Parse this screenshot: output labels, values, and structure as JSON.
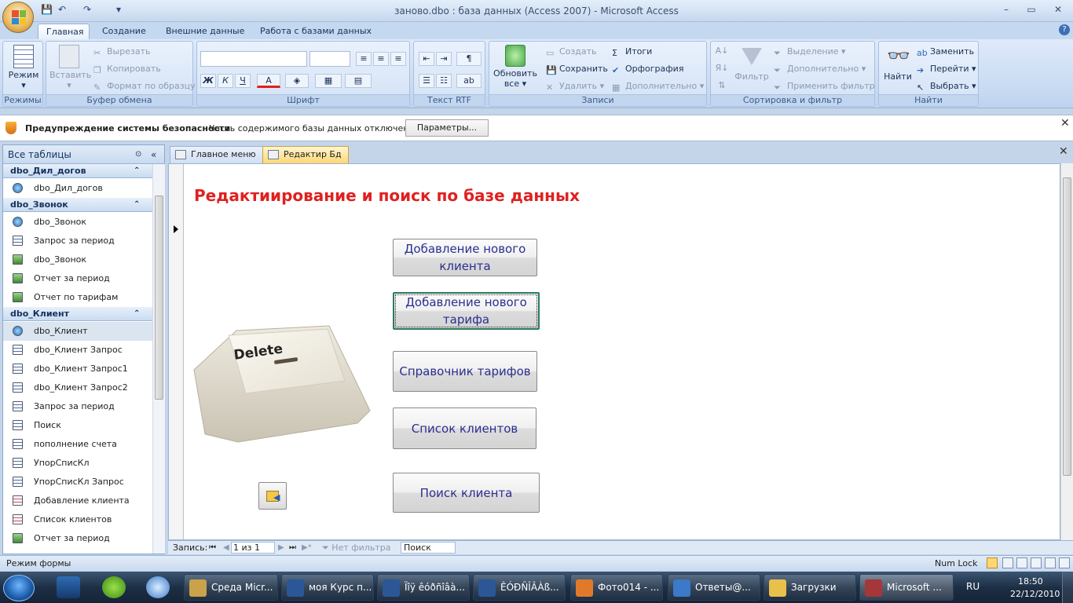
{
  "window": {
    "title": "заново.dbo : база данных (Access 2007) - Microsoft Access"
  },
  "ribbon_tabs": [
    "Главная",
    "Создание",
    "Внешние данные",
    "Работа с базами данных"
  ],
  "ribbon": {
    "modes": {
      "view_label": "Режим",
      "group": "Режимы"
    },
    "clipboard": {
      "paste": "Вставить",
      "cut": "Вырезать",
      "copy": "Копировать",
      "format_painter": "Формат по образцу",
      "group": "Буфер обмена"
    },
    "font": {
      "group": "Шрифт",
      "bold": "Ж",
      "italic": "К",
      "underline": "Ч",
      "font_color": "А"
    },
    "rtf": {
      "group": "Текст RTF"
    },
    "records": {
      "refresh": "Обновить",
      "refresh_all": "все",
      "new": "Создать",
      "save": "Сохранить",
      "delete": "Удалить",
      "totals": "Итоги",
      "spelling": "Орфография",
      "more": "Дополнительно",
      "group": "Записи"
    },
    "sort": {
      "filter": "Фильтр",
      "selection": "Выделение",
      "advanced": "Дополнительно",
      "toggle": "Применить фильтр",
      "group": "Сортировка и фильтр"
    },
    "find": {
      "find": "Найти",
      "replace": "Заменить",
      "goto": "Перейти",
      "select": "Выбрать",
      "group": "Найти"
    }
  },
  "security_bar": {
    "title": "Предупреждение системы безопасности",
    "text": "Часть содержимого базы данных отключено",
    "options_button": "Параметры..."
  },
  "nav_pane": {
    "header": "Все таблицы",
    "groups": [
      {
        "name": "dbo_Дил_догов",
        "items": [
          {
            "label": "dbo_Дил_догов",
            "type": "table"
          }
        ]
      },
      {
        "name": "dbo_Звонок",
        "items": [
          {
            "label": "dbo_Звонок",
            "type": "table"
          },
          {
            "label": "Запрос за период",
            "type": "query"
          },
          {
            "label": "dbo_Звонок",
            "type": "report"
          },
          {
            "label": "Отчет за период",
            "type": "report"
          },
          {
            "label": "Отчет по тарифам",
            "type": "report"
          }
        ]
      },
      {
        "name": "dbo_Клиент",
        "items": [
          {
            "label": "dbo_Клиент",
            "type": "table"
          },
          {
            "label": "dbo_Клиент Запрос",
            "type": "query"
          },
          {
            "label": "dbo_Клиент Запрос1",
            "type": "query"
          },
          {
            "label": "dbo_Клиент Запрос2",
            "type": "query"
          },
          {
            "label": "Запрос за период",
            "type": "query"
          },
          {
            "label": "Поиск",
            "type": "query"
          },
          {
            "label": "пополнение счета",
            "type": "query"
          },
          {
            "label": "УпорСписКл",
            "type": "query"
          },
          {
            "label": "УпорСписКл Запрос",
            "type": "query"
          },
          {
            "label": "Добавление клиента",
            "type": "form"
          },
          {
            "label": "Список клиентов",
            "type": "form"
          },
          {
            "label": "Отчет за период",
            "type": "report"
          }
        ]
      }
    ]
  },
  "doc_tabs": [
    "Главное меню",
    "Редактир Бд"
  ],
  "form": {
    "title": "Редактиирование и поиск по базе данных",
    "buttons": [
      "Добавление нового клиента",
      "Добавление нового тарифа",
      "Справочник тарифов",
      "Список клиентов",
      "Поиск клиента"
    ],
    "image_key_text": "Delete"
  },
  "record_nav": {
    "label": "Запись:",
    "position": "1 из 1",
    "filter": "Нет фильтра",
    "search": "Поиск"
  },
  "status_bar": {
    "mode": "Режим формы",
    "numlock": "Num Lock"
  },
  "taskbar": {
    "items": [
      "Среда Micr...",
      "моя Курс п...",
      "Ïîÿ êóðñîâà...",
      "ÊÓÐÑÎÂÀß...",
      "Фото014 - ...",
      "Ответы@...",
      "Загрузки",
      "Microsoft ..."
    ],
    "lang": "RU",
    "time": "18:50",
    "date": "22/12/2010"
  }
}
